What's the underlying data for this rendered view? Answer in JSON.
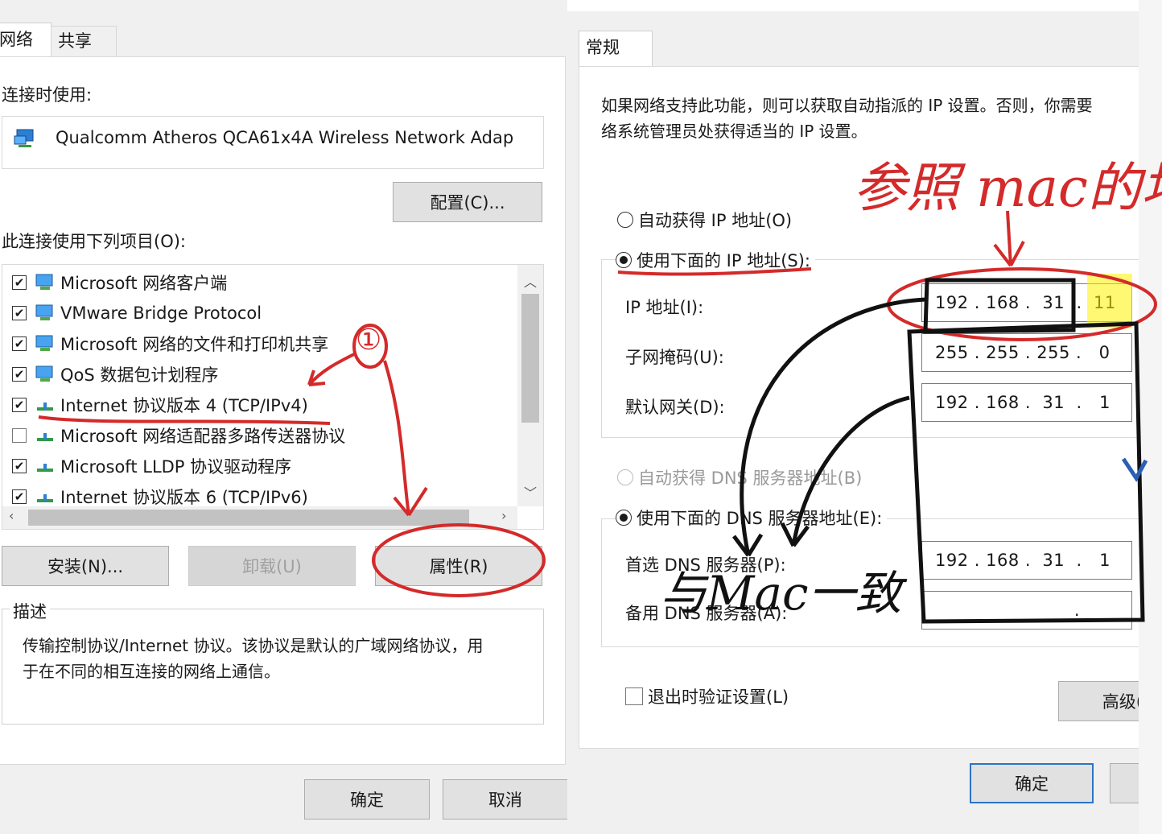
{
  "left_dialog": {
    "tabs": [
      "网络",
      "共享"
    ],
    "connect_using_label": "连接时使用:",
    "adapter_name": "Qualcomm Atheros QCA61x4A Wireless Network Adap",
    "configure_button": "配置(C)...",
    "items_label": "此连接使用下列项目(O):",
    "items": [
      {
        "label": "Microsoft 网络客户端",
        "checked": true
      },
      {
        "label": "VMware Bridge Protocol",
        "checked": true
      },
      {
        "label": "Microsoft 网络的文件和打印机共享",
        "checked": true
      },
      {
        "label": "QoS 数据包计划程序",
        "checked": true
      },
      {
        "label": "Internet 协议版本 4 (TCP/IPv4)",
        "checked": true
      },
      {
        "label": "Microsoft 网络适配器多路传送器协议",
        "checked": false
      },
      {
        "label": "Microsoft LLDP 协议驱动程序",
        "checked": true
      },
      {
        "label": "Internet 协议版本 6 (TCP/IPv6)",
        "checked": true
      }
    ],
    "install_button": "安装(N)...",
    "uninstall_button": "卸载(U)",
    "properties_button": "属性(R)",
    "description_label": "描述",
    "description_text_1": "传输控制协议/Internet 协议。该协议是默认的广域网络协议，用",
    "description_text_2": "于在不同的相互连接的网络上通信。",
    "ok_button": "确定",
    "cancel_button": "取消"
  },
  "right_dialog": {
    "tab": "常规",
    "intro_1": "如果网络支持此功能，则可以获取自动指派的 IP 设置。否则，你需要",
    "intro_2": "络系统管理员处获得适当的 IP 设置。",
    "auto_ip": "自动获得 IP 地址(O)",
    "manual_ip": "使用下面的 IP 地址(S):",
    "ip_label": "IP 地址(I):",
    "ip_value": "192 . 168 .  31  .  11",
    "mask_label": "子网掩码(U):",
    "mask_value": "255 . 255 . 255 .   0",
    "gateway_label": "默认网关(D):",
    "gateway_value": "192 . 168 .  31  .   1",
    "auto_dns": "自动获得 DNS 服务器地址(B)",
    "manual_dns": "使用下面的 DNS 服务器地址(E):",
    "pref_dns_label": "首选 DNS 服务器(P):",
    "pref_dns_value": "192 . 168 .  31  .   1",
    "alt_dns_label": "备用 DNS 服务器(A):",
    "alt_dns_value": ".",
    "validate_label": "退出时验证设置(L)",
    "advanced_button": "高级(",
    "ok_button": "确定"
  },
  "annotations": {
    "marker_1": "①",
    "note_top": "参照 mac的地",
    "note_bottom": "与Mac一致",
    "check_mark": "v"
  },
  "colors": {
    "red_ink": "#d42a2a",
    "black_ink": "#111111",
    "highlight": "#fff200",
    "accent_blue": "#2b74c9"
  }
}
